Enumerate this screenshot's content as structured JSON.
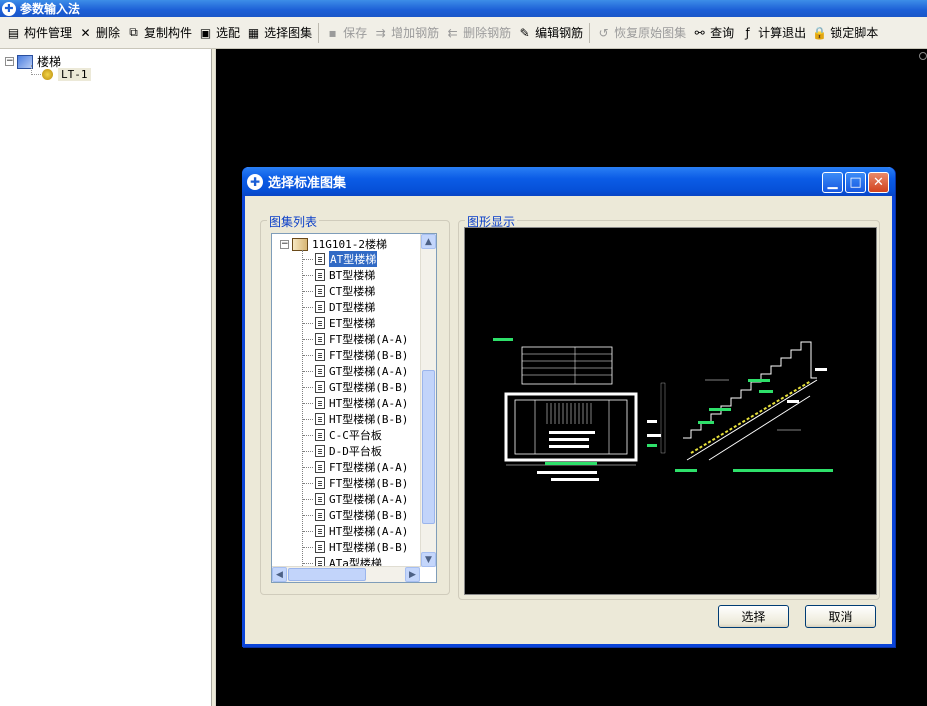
{
  "app": {
    "title": "参数输入法"
  },
  "toolbar": {
    "items": [
      {
        "label": "构件管理",
        "icon": "component-manager-icon",
        "enabled": true
      },
      {
        "label": "删除",
        "icon": "delete-x-icon",
        "enabled": true
      },
      {
        "label": "复制构件",
        "icon": "copy-icon",
        "enabled": true
      },
      {
        "label": "选配",
        "icon": "select-config-icon",
        "enabled": true
      },
      {
        "label": "选择图集",
        "icon": "atlas-icon",
        "enabled": true
      },
      {
        "label": "保存",
        "icon": "save-icon",
        "enabled": false
      },
      {
        "label": "增加钢筋",
        "icon": "add-rebar-icon",
        "enabled": false
      },
      {
        "label": "删除钢筋",
        "icon": "delete-rebar-icon",
        "enabled": false
      },
      {
        "label": "编辑钢筋",
        "icon": "edit-rebar-icon",
        "enabled": true
      },
      {
        "label": "恢复原始图集",
        "icon": "restore-icon",
        "enabled": false
      },
      {
        "label": "查询",
        "icon": "binoculars-icon",
        "enabled": true
      },
      {
        "label": "计算退出",
        "icon": "fx-icon",
        "enabled": true
      },
      {
        "label": "锁定脚本",
        "icon": "lock-icon",
        "enabled": true
      }
    ]
  },
  "tree": {
    "root": "楼梯",
    "child": "LT-1"
  },
  "dialog": {
    "title": "选择标准图集",
    "list_label": "图集列表",
    "preview_label": "图形显示",
    "atlas_root": "11G101-2楼梯",
    "items": [
      "AT型楼梯",
      "BT型楼梯",
      "CT型楼梯",
      "DT型楼梯",
      "ET型楼梯",
      "FT型楼梯(A-A)",
      "FT型楼梯(B-B)",
      "GT型楼梯(A-A)",
      "GT型楼梯(B-B)",
      "HT型楼梯(A-A)",
      "HT型楼梯(B-B)",
      "C-C平台板",
      "D-D平台板",
      "FT型楼梯(A-A)",
      "FT型楼梯(B-B)",
      "GT型楼梯(A-A)",
      "GT型楼梯(B-B)",
      "HT型楼梯(A-A)",
      "HT型楼梯(B-B)",
      "ATa型楼梯"
    ],
    "selected_item": "AT型楼梯",
    "select_button": "选择",
    "cancel_button": "取消"
  }
}
